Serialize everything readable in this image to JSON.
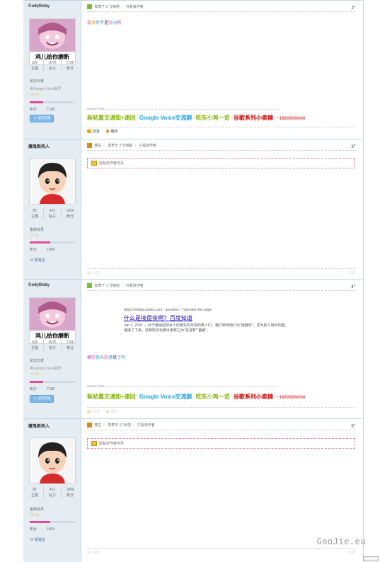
{
  "posts": [
    {
      "user": {
        "name": "CodyDoby",
        "avatar_caption": "鸡儿给你磨断",
        "threads": "325",
        "posts": "3676",
        "credits": "7196",
        "label_threads": "主题",
        "label_posts": "帖子",
        "label_credits": "积分",
        "group": "论坛元老",
        "sub": "卖Google Voice靓号",
        "medal": "☺☺",
        "credit_label": "积分",
        "credit_value": "7196",
        "qq": "QQ交谈"
      },
      "meta": {
        "posted": "发表于 2 分钟前",
        "only_author": "只看该作者",
        "floor": "2",
        "floor_sup": "#"
      },
      "content": [
        "拔",
        "会",
        "伏",
        "不",
        "是",
        "好",
        "闲",
        "啊"
      ],
      "sig_date": "2022/1/7 0:00",
      "signatures": [
        {
          "text": "新帖重文通知+速回",
          "color": "#85b400"
        },
        {
          "text": "Google Voice交流群",
          "color": "#1ea0e0"
        },
        {
          "text": "吃灰小鸡一览",
          "color": "#85b400"
        },
        {
          "text": "谷歌系列小卖摊",
          "color": "#d00000"
        },
        {
          "text": "~18605000000",
          "color": "#e05050"
        }
      ],
      "actions": {
        "reply": "回复",
        "edit": "编辑"
      }
    },
    {
      "user": {
        "name": "魔鬼新肉人",
        "threads": "82",
        "posts": "412",
        "credits": "1894",
        "label_threads": "主题",
        "label_posts": "帖子",
        "label_credits": "积分",
        "group": "金牌会员",
        "medal": "☺♨",
        "credit_label": "积分",
        "credit_value": "1894",
        "msg": "发消息"
      },
      "meta": {
        "host": "楼主",
        "posted": "发表于 2 分钟前",
        "only_author": "只看该作者",
        "floor": "3",
        "floor_sup": "#"
      },
      "lock": "此帖仅作者可见",
      "actions": {
        "reply": "回复",
        "rt": "举报"
      }
    },
    {
      "user": {
        "name": "CodyDoby",
        "avatar_caption": "鸡儿给你磨断",
        "threads": "325",
        "posts": "3676",
        "credits": "7196",
        "label_threads": "主题",
        "label_posts": "帖子",
        "label_credits": "积分",
        "group": "论坛元老",
        "sub": "卖Google Voice靓号",
        "medal": "☺☺",
        "credit_label": "积分",
        "credit_value": "7196",
        "qq": "QQ交谈"
      },
      "meta": {
        "posted": "发表于 1 分钟前",
        "only_author": "只看该作者",
        "floor": "4",
        "floor_sup": "#"
      },
      "search": {
        "url": "https://zhidao.baidu.com › question › Translate this page",
        "title": "什么是接盘侠啊?_百度知道",
        "snippet": "Jan 1, 2020 — 对于接纳这种女人的老实的无辜的男人们，我们称呼他们为\"接盘侠\"。意为别人抛出的盘，他接了下来。这种情况也被大家称之为\"喜当爹\"\"备胎\"。"
      },
      "content": [
        "相",
        "信",
        "我",
        "人",
        "愿",
        "意",
        "接",
        "了",
        "吗"
      ],
      "sig_date": "2022/1/7 0:00",
      "signatures": [
        {
          "text": "新帖重文通知+速回",
          "color": "#85b400"
        },
        {
          "text": "Google Voice交流群",
          "color": "#1ea0e0"
        },
        {
          "text": "吃灰小鸡一览",
          "color": "#85b400"
        },
        {
          "text": "谷歌系列小卖摊",
          "color": "#d00000"
        },
        {
          "text": "~18605000000",
          "color": "#e05050"
        }
      ],
      "actions": {
        "reply": "回复",
        "edit": "编辑"
      }
    },
    {
      "user": {
        "name": "魔鬼新肉人",
        "threads": "82",
        "posts": "412",
        "credits": "1894",
        "label_threads": "主题",
        "label_posts": "帖子",
        "label_credits": "积分",
        "group": "金牌会员",
        "medal": "☺♨",
        "credit_label": "积分",
        "credit_value": "1894",
        "msg": "发消息"
      },
      "meta": {
        "host": "楼主",
        "posted": "发表于 11 秒前",
        "only_author": "只看该作者",
        "floor": "5",
        "floor_sup": "#"
      },
      "lock": "此帖仅作者可见",
      "actions": {
        "reply": "回复",
        "rt": "举报"
      }
    }
  ],
  "watermark": "GooJie.eu",
  "colors": {
    "sidebar": "#e5edf2",
    "border": "#c2d5e3",
    "pink": "#e24b9b"
  }
}
